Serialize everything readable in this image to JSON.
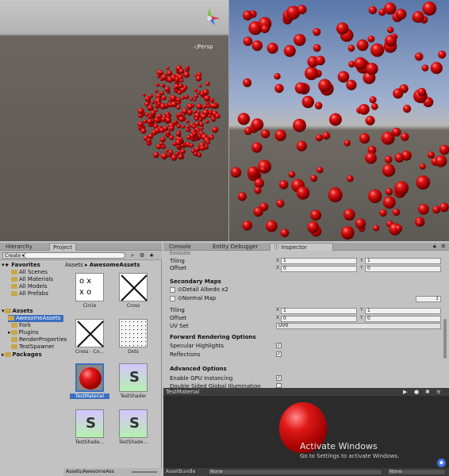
{
  "scene": {
    "persp_label": "◁Persp"
  },
  "project": {
    "tabs": [
      "Hierarchy",
      "Project"
    ],
    "create_label": "Create ▾",
    "favorites": {
      "label": "Favorites",
      "items": [
        "All Scenes",
        "All Materials",
        "All Models",
        "All Prefabs"
      ]
    },
    "assets": {
      "label": "Assets",
      "items": [
        "AwesomeAssets",
        "Fork",
        "Plugins",
        "RenderProperties",
        "TestSpawner"
      ]
    },
    "packages_label": "Packages",
    "breadcrumb": [
      "Assets",
      "AwesomeAssets"
    ],
    "thumbnails": [
      "Circle",
      "Cross",
      "Cross - Co...",
      "Dots",
      "TestMaterial",
      "TestShader",
      "TestShade...",
      "TestShade..."
    ],
    "bottom_path": "Assets/AwesomeAss"
  },
  "inspector": {
    "tabs": [
      "Console",
      "Entity Debugger",
      "Inspector"
    ],
    "top_section_label": "Emission",
    "tiling_label": "Tiling",
    "offset_label": "Offset",
    "tiling1": {
      "x": "1",
      "y": "1"
    },
    "offset1": {
      "x": "0",
      "y": "0"
    },
    "secondary_maps_label": "Secondary Maps",
    "detail_albedo_label": "Detail Albedo x2",
    "normal_map_label": "Normal Map",
    "normal_map_value": "1",
    "tiling2": {
      "x": "1",
      "y": "1"
    },
    "offset2": {
      "x": "0",
      "y": "0"
    },
    "uv_set_label": "UV Set",
    "uv_set_value": "UV0",
    "forward_label": "Forward Rendering Options",
    "specular_label": "Specular Highlights",
    "reflections_label": "Reflections",
    "advanced_label": "Advanced Options",
    "gpu_label": "Enable GPU Instancing",
    "double_sided_label": "Double Sided Global Illumination"
  },
  "preview": {
    "title": "TestMaterial",
    "asset_bundle_label": "AssetBundle",
    "asset_bundle_value": "None",
    "asset_bundle_value2": "None",
    "activate_title": "Activate Windows",
    "activate_sub": "Go to Settings to activate Windows."
  },
  "colors": {
    "sphere_red": "#d01010",
    "sky_blue": "#6a86b8"
  },
  "icons": [
    "lock-icon",
    "menu-icon",
    "search-icon",
    "folder-icon",
    "star-icon",
    "settings-icon"
  ]
}
